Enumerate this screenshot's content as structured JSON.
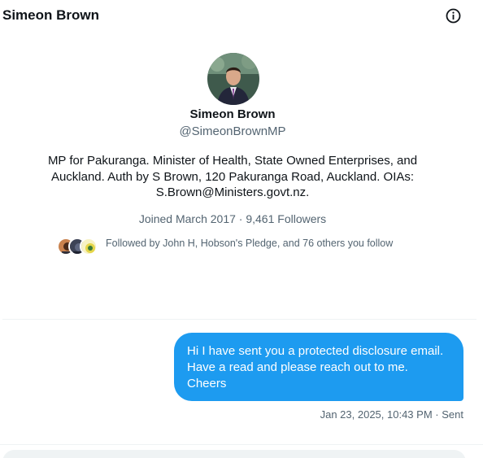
{
  "header": {
    "title": "Simeon Brown",
    "info_icon": "info-circle-icon"
  },
  "profile": {
    "name": "Simeon Brown",
    "handle": "@SimeonBrownMP",
    "bio": "MP for Pakuranga. Minister of Health, State Owned Enterprises, and Auckland. Auth by S Brown, 120 Pakuranga Road, Auckland. OIAs: S.Brown@Ministers.govt.nz.",
    "joined": "Joined March 2017",
    "separator": "·",
    "followers": "9,461 Followers",
    "followed_by": "Followed by John H, Hobson's Pledge, and 76 others you follow"
  },
  "conversation": {
    "messages": [
      {
        "lines": [
          "Hi I have sent you a protected disclosure email.",
          "Have a read and please reach out to me.",
          "Cheers"
        ],
        "timestamp": "Jan 23, 2025, 10:43 PM",
        "separator": "·",
        "status": "Sent"
      }
    ]
  },
  "colors": {
    "accent": "#1d9bf0",
    "text_primary": "#0f1419",
    "text_secondary": "#536471",
    "divider": "#eff3f4"
  }
}
